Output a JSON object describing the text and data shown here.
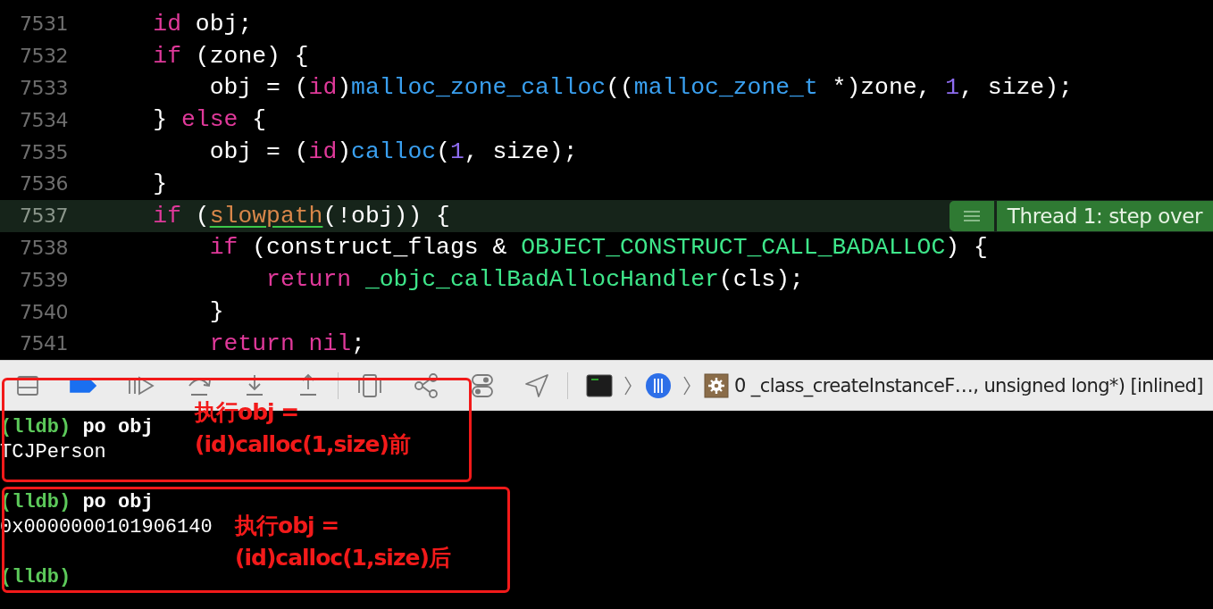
{
  "editor": {
    "lines": [
      {
        "number": "7531",
        "current": false,
        "tokens": [
          {
            "text": "    id",
            "kind": "keyword"
          },
          {
            "text": " obj;",
            "kind": "plain"
          }
        ]
      },
      {
        "number": "7532",
        "current": false,
        "tokens": [
          {
            "text": "    if",
            "kind": "keyword"
          },
          {
            "text": " (zone) {",
            "kind": "plain"
          }
        ]
      },
      {
        "number": "7533",
        "current": false,
        "tokens": [
          {
            "text": "        obj = (",
            "kind": "plain"
          },
          {
            "text": "id",
            "kind": "keyword"
          },
          {
            "text": ")",
            "kind": "plain"
          },
          {
            "text": "malloc_zone_calloc",
            "kind": "function"
          },
          {
            "text": "((",
            "kind": "plain"
          },
          {
            "text": "malloc_zone_t",
            "kind": "function"
          },
          {
            "text": " *)zone, ",
            "kind": "plain"
          },
          {
            "text": "1",
            "kind": "number"
          },
          {
            "text": ", size);",
            "kind": "plain"
          }
        ]
      },
      {
        "number": "7534",
        "current": false,
        "tokens": [
          {
            "text": "    } ",
            "kind": "plain"
          },
          {
            "text": "else",
            "kind": "keyword"
          },
          {
            "text": " {",
            "kind": "plain"
          }
        ]
      },
      {
        "number": "7535",
        "current": false,
        "tokens": [
          {
            "text": "        obj = (",
            "kind": "plain"
          },
          {
            "text": "id",
            "kind": "keyword"
          },
          {
            "text": ")",
            "kind": "plain"
          },
          {
            "text": "calloc",
            "kind": "function"
          },
          {
            "text": "(",
            "kind": "plain"
          },
          {
            "text": "1",
            "kind": "number"
          },
          {
            "text": ", size);",
            "kind": "plain"
          }
        ]
      },
      {
        "number": "7536",
        "current": false,
        "tokens": [
          {
            "text": "    }",
            "kind": "plain"
          }
        ]
      },
      {
        "number": "7537",
        "current": true,
        "tokens": [
          {
            "text": "    if",
            "kind": "keyword"
          },
          {
            "text": " (",
            "kind": "plain"
          },
          {
            "text": "slowpath",
            "kind": "underlined"
          },
          {
            "text": "(!obj)) {",
            "kind": "plain"
          }
        ]
      },
      {
        "number": "7538",
        "current": false,
        "tokens": [
          {
            "text": "        if",
            "kind": "keyword"
          },
          {
            "text": " (construct_flags & ",
            "kind": "plain"
          },
          {
            "text": "OBJECT_CONSTRUCT_CALL_BADALLOC",
            "kind": "macro"
          },
          {
            "text": ") {",
            "kind": "plain"
          }
        ]
      },
      {
        "number": "7539",
        "current": false,
        "tokens": [
          {
            "text": "            return ",
            "kind": "keyword"
          },
          {
            "text": "_objc_callBadAllocHandler",
            "kind": "macro"
          },
          {
            "text": "(cls);",
            "kind": "plain"
          }
        ]
      },
      {
        "number": "7540",
        "current": false,
        "tokens": [
          {
            "text": "        }",
            "kind": "plain"
          }
        ]
      },
      {
        "number": "7541",
        "current": false,
        "tokens": [
          {
            "text": "        return nil",
            "kind": "keyword"
          },
          {
            "text": ";",
            "kind": "plain"
          }
        ]
      }
    ],
    "thread_marker": {
      "label": "Thread 1: step over"
    }
  },
  "debug_bar": {
    "breakpoints_active": true,
    "frame": "0 _class_createInstanceF…, unsigned long*) [inlined]"
  },
  "console": {
    "groups": [
      {
        "lines": [
          {
            "tokens": [
              {
                "text": "(lldb)",
                "kind": "prompt"
              },
              {
                "text": " po obj",
                "kind": "command"
              }
            ]
          },
          {
            "tokens": [
              {
                "text": "TCJPerson",
                "kind": "output"
              }
            ]
          }
        ]
      },
      {
        "lines": [
          {
            "tokens": [
              {
                "text": "(lldb)",
                "kind": "prompt"
              },
              {
                "text": " po obj",
                "kind": "command"
              }
            ]
          },
          {
            "tokens": [
              {
                "text": "0x0000000101906140",
                "kind": "output"
              }
            ]
          }
        ]
      },
      {
        "lines": [
          {
            "tokens": [
              {
                "text": "(lldb)",
                "kind": "prompt"
              }
            ]
          }
        ]
      }
    ]
  },
  "annotations": [
    {
      "lines": [
        "执行obj =",
        "(id)calloc(1,size)前"
      ]
    },
    {
      "lines": [
        "执行obj =",
        "(id)calloc(1,size)后"
      ]
    }
  ]
}
